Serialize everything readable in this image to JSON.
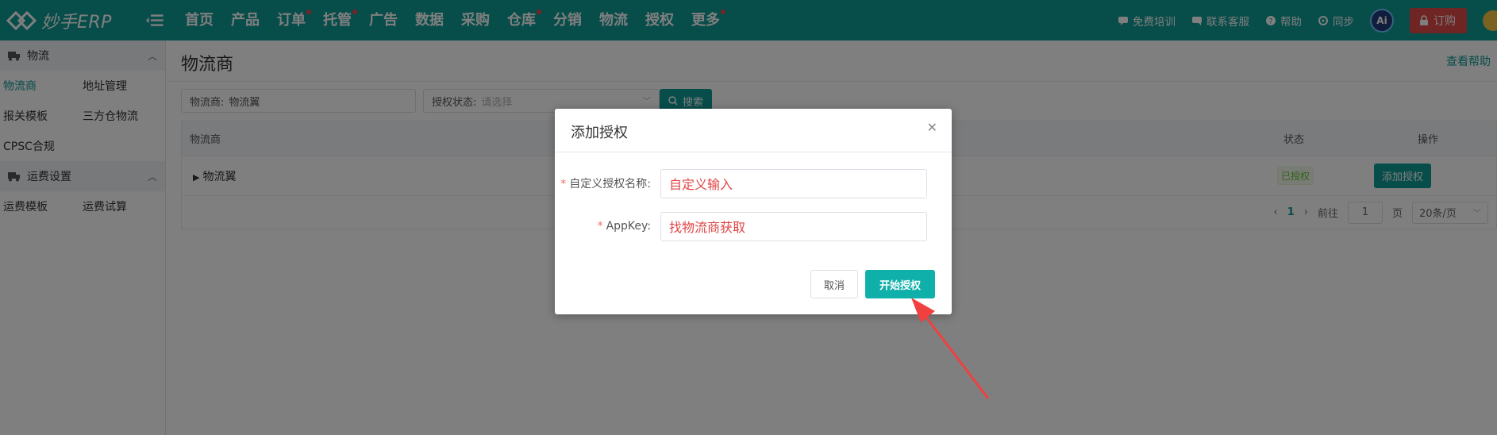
{
  "app": {
    "logo_text": "妙手ERP"
  },
  "nav": [
    {
      "label": "首页",
      "dot": false
    },
    {
      "label": "产品",
      "dot": false
    },
    {
      "label": "订单",
      "dot": true
    },
    {
      "label": "托管",
      "dot": true
    },
    {
      "label": "广告",
      "dot": false
    },
    {
      "label": "数据",
      "dot": false
    },
    {
      "label": "采购",
      "dot": false
    },
    {
      "label": "仓库",
      "dot": true
    },
    {
      "label": "分销",
      "dot": false
    },
    {
      "label": "物流",
      "dot": false
    },
    {
      "label": "授权",
      "dot": false
    },
    {
      "label": "更多",
      "dot": true
    }
  ],
  "topright": {
    "training": "免费培训",
    "support": "联系客服",
    "help": "帮助",
    "sync": "同步",
    "ai": "Ai",
    "buy": "订购"
  },
  "sidebar": {
    "group1": "物流",
    "group1_items": [
      "物流商",
      "地址管理",
      "报关模板",
      "三方仓物流",
      "CPSC合规"
    ],
    "group2": "运费设置",
    "group2_items": [
      "运费模板",
      "运费试算"
    ]
  },
  "main": {
    "title": "物流商",
    "help_link": "查看帮助",
    "filter_carrier_label": "物流商:",
    "filter_carrier_value": "物流翼",
    "filter_status_label": "授权状态:",
    "filter_status_placeholder": "请选择",
    "search_button": "搜索",
    "table": {
      "col_name": "物流商",
      "col_status": "状态",
      "col_op": "操作",
      "row_name": "物流翼",
      "row_status": "已授权",
      "row_action": "添加授权"
    },
    "pager": {
      "current_page": "1",
      "goto_label": "前往",
      "goto_value": "1",
      "page_unit": "页",
      "page_size": "20条/页"
    }
  },
  "dialog": {
    "title": "添加授权",
    "field1_label": "自定义授权名称:",
    "field1_value": "自定义输入",
    "field2_label": "AppKey:",
    "field2_value": "找物流商获取",
    "cancel": "取消",
    "confirm": "开始授权"
  },
  "colors": {
    "brand": "#0f9a95",
    "accent_button": "#0fb0aa",
    "danger": "#e04a4a",
    "annotation": "#f04040"
  }
}
